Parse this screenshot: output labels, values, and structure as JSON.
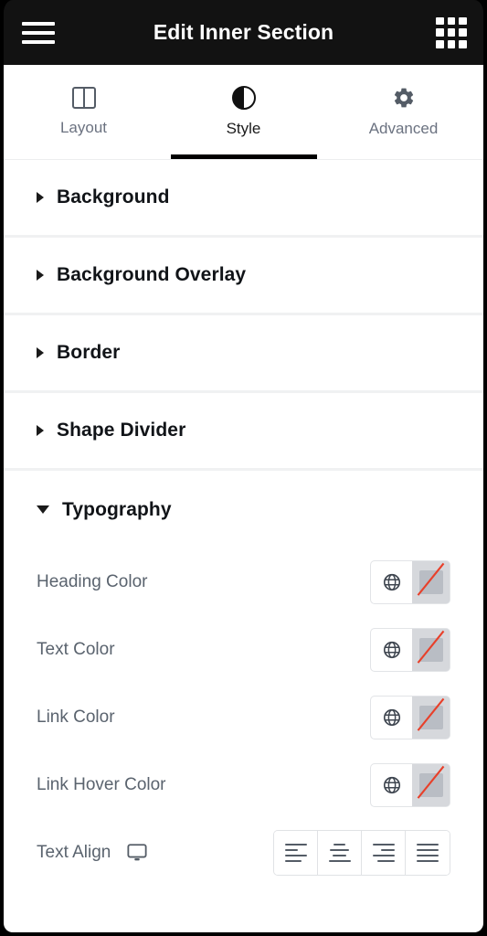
{
  "header": {
    "title": "Edit Inner Section",
    "menu_icon": "hamburger-icon",
    "apps_icon": "grid-icon"
  },
  "tabs": [
    {
      "label": "Layout",
      "icon": "columns-icon",
      "active": false
    },
    {
      "label": "Style",
      "icon": "contrast-icon",
      "active": true
    },
    {
      "label": "Advanced",
      "icon": "gear-icon",
      "active": false
    }
  ],
  "sections": [
    {
      "title": "Background",
      "expanded": false,
      "caret": "caret-right-icon"
    },
    {
      "title": "Background Overlay",
      "expanded": false,
      "caret": "caret-right-icon"
    },
    {
      "title": "Border",
      "expanded": false,
      "caret": "caret-right-icon"
    },
    {
      "title": "Shape Divider",
      "expanded": false,
      "caret": "caret-right-icon"
    },
    {
      "title": "Typography",
      "expanded": true,
      "caret": "caret-down-icon"
    }
  ],
  "typography_controls": [
    {
      "label": "Heading Color",
      "type": "color",
      "value": "",
      "global_icon": "globe-icon",
      "empty_swatch": true
    },
    {
      "label": "Text Color",
      "type": "color",
      "value": "",
      "global_icon": "globe-icon",
      "empty_swatch": true
    },
    {
      "label": "Link Color",
      "type": "color",
      "value": "",
      "global_icon": "globe-icon",
      "empty_swatch": true
    },
    {
      "label": "Link Hover Color",
      "type": "color",
      "value": "",
      "global_icon": "globe-icon",
      "empty_swatch": true
    }
  ],
  "text_align": {
    "label": "Text Align",
    "device_icon": "desktop-icon",
    "options": [
      {
        "name": "align-left",
        "label": "Left"
      },
      {
        "name": "align-center",
        "label": "Center"
      },
      {
        "name": "align-right",
        "label": "Right"
      },
      {
        "name": "align-justify",
        "label": "Justify"
      }
    ],
    "selected": ""
  },
  "colors": {
    "header_bg": "#121212",
    "panel_bg": "#ffffff",
    "active_tab": "#000000",
    "label_text": "#5a636e",
    "title_text": "#111418",
    "divider": "#f0f1f2",
    "swatch_slash": "#e8402a"
  }
}
